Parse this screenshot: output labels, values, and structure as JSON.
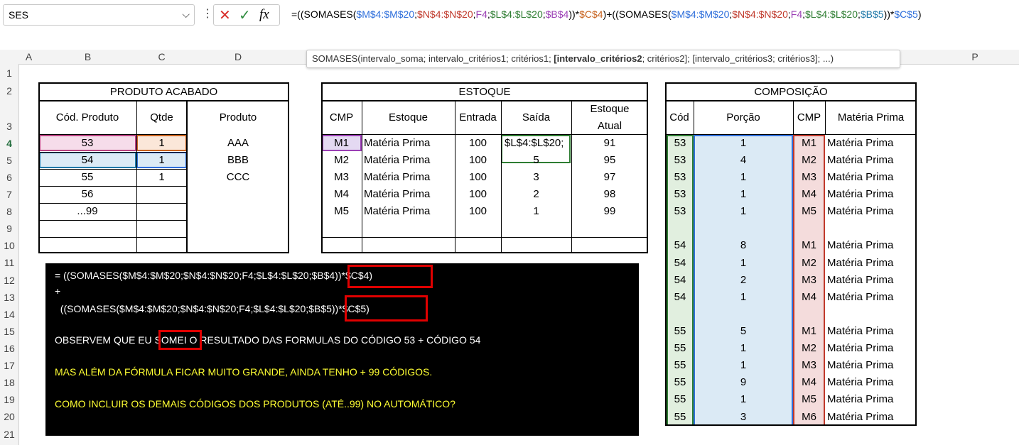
{
  "formula_bar": {
    "name_box": "SES",
    "more_icon": "⋮",
    "cancel_icon": "✕",
    "enter_icon": "✓",
    "fx_label": "fx",
    "formula_parts": [
      {
        "t": "=((SOMASES(",
        "c": "plain"
      },
      {
        "t": "$M$4:$M$20",
        "c": "blue"
      },
      {
        "t": ";",
        "c": "plain"
      },
      {
        "t": "$N$4:$N$20",
        "c": "red"
      },
      {
        "t": ";",
        "c": "plain"
      },
      {
        "t": "F4",
        "c": "purple"
      },
      {
        "t": ";",
        "c": "plain"
      },
      {
        "t": "$L$4:$L$20",
        "c": "green"
      },
      {
        "t": ";",
        "c": "plain"
      },
      {
        "t": "$B$4",
        "c": "purple"
      },
      {
        "t": "))*",
        "c": "plain"
      },
      {
        "t": "$C$4",
        "c": "orange"
      },
      {
        "t": ")+((SOMASES(",
        "c": "plain"
      },
      {
        "t": "$M$4:$M$20",
        "c": "blue"
      },
      {
        "t": ";",
        "c": "plain"
      },
      {
        "t": "$N$4:$N$20",
        "c": "red"
      },
      {
        "t": ";",
        "c": "plain"
      },
      {
        "t": "F4",
        "c": "purple"
      },
      {
        "t": ";",
        "c": "plain"
      },
      {
        "t": "$L$4:$L$20",
        "c": "green"
      },
      {
        "t": ";",
        "c": "plain"
      },
      {
        "t": "$B$5",
        "c": "teal"
      },
      {
        "t": "))*",
        "c": "plain"
      },
      {
        "t": "$C$5",
        "c": "blue"
      },
      {
        "t": ")",
        "c": "plain"
      }
    ]
  },
  "tooltip": {
    "pre": "SOMASES(intervalo_soma; intervalo_critérios1; critérios1; ",
    "bold": "[intervalo_critérios2",
    "post": "; critérios2]; [intervalo_critérios3; critérios3]; ...)"
  },
  "columns": [
    "A",
    "B",
    "C",
    "D",
    "",
    "",
    "",
    "",
    "",
    "",
    "",
    "",
    "",
    "",
    "",
    "P"
  ],
  "rows": [
    "1",
    "2",
    "3",
    "4",
    "5",
    "6",
    "7",
    "8",
    "9",
    "10",
    "11",
    "12",
    "13",
    "14",
    "15",
    "16",
    "17",
    "18",
    "19",
    "20",
    "21"
  ],
  "produto_acabado": {
    "title": "PRODUTO ACABADO",
    "headers": [
      "Cód. Produto",
      "Qtde",
      "Produto"
    ],
    "rows": [
      [
        "53",
        "1",
        "AAA"
      ],
      [
        "54",
        "1",
        "BBB"
      ],
      [
        "55",
        "1",
        "CCC"
      ],
      [
        "56",
        "",
        ""
      ],
      [
        "...99",
        "",
        ""
      ],
      [
        "",
        "",
        ""
      ],
      [
        "",
        "",
        ""
      ]
    ]
  },
  "estoque": {
    "title": "ESTOQUE",
    "headers": [
      "CMP",
      "Estoque",
      "Entrada",
      "Saída",
      "Estoque",
      "Atual"
    ],
    "rows": [
      [
        "M1",
        "Matéria Prima",
        "100",
        "$L$4:$L$20;",
        "91"
      ],
      [
        "M2",
        "Matéria Prima",
        "100",
        "5",
        "95"
      ],
      [
        "M3",
        "Matéria Prima",
        "100",
        "3",
        "97"
      ],
      [
        "M4",
        "Matéria Prima",
        "100",
        "2",
        "98"
      ],
      [
        "M5",
        "Matéria Prima",
        "100",
        "1",
        "99"
      ]
    ]
  },
  "composicao": {
    "title": "COMPOSIÇÃO",
    "headers": [
      "Cód",
      "Porção",
      "CMP",
      "Matéria Prima"
    ],
    "rows": [
      [
        "53",
        "1",
        "M1",
        "Matéria Prima"
      ],
      [
        "53",
        "4",
        "M2",
        "Matéria Prima"
      ],
      [
        "53",
        "1",
        "M3",
        "Matéria Prima"
      ],
      [
        "53",
        "1",
        "M4",
        "Matéria Prima"
      ],
      [
        "53",
        "1",
        "M5",
        "Matéria Prima"
      ],
      [
        "",
        "",
        "",
        ""
      ],
      [
        "54",
        "8",
        "M1",
        "Matéria Prima"
      ],
      [
        "54",
        "1",
        "M2",
        "Matéria Prima"
      ],
      [
        "54",
        "2",
        "M3",
        "Matéria Prima"
      ],
      [
        "54",
        "1",
        "M4",
        "Matéria Prima"
      ],
      [
        "",
        "",
        "",
        ""
      ],
      [
        "55",
        "5",
        "M1",
        "Matéria Prima"
      ],
      [
        "55",
        "1",
        "M2",
        "Matéria Prima"
      ],
      [
        "55",
        "1",
        "M3",
        "Matéria Prima"
      ],
      [
        "55",
        "9",
        "M4",
        "Matéria Prima"
      ],
      [
        "55",
        "1",
        "M5",
        "Matéria Prima"
      ],
      [
        "55",
        "3",
        "M6",
        "Matéria Prima"
      ]
    ]
  },
  "note": {
    "line1": "= ((SOMASES($M$4:$M$20;$N$4:$N$20;F4;$L$4:$L$20;$B$4))*$C$4)",
    "line2": "+",
    "line3": "  ((SOMASES($M$4:$M$20;$N$4:$N$20;F4;$L$4:$L$20;$B$5))*$C$5)",
    "line4": "OBSERVEM QUE EU SOMEI O RESULTADO DAS FORMULAS DO CÓDIGO 53  + CÓDIGO 54",
    "line5": "MAS ALÉM DA FÓRMULA FICAR MUITO GRANDE, AINDA TENHO + 99 CÓDIGOS.",
    "line6": "COMO INCLUIR OS DEMAIS CÓDIGOS DOS PRODUTOS (ATÉ..99) NO AUTOMÁTICO?"
  },
  "colors": {
    "formula_blue": "#2f6fdb",
    "formula_red": "#c0392b",
    "formula_purple": "#9b3fb5",
    "formula_green": "#2e7d32",
    "formula_orange": "#c8621d",
    "formula_teal": "#1f78a8",
    "highlight_pink": "#f6dcea",
    "highlight_blue": "#dbeaf5",
    "highlight_purple": "#e4d9f2",
    "note_yellow": "#ffff33",
    "annotation_red": "#e00000"
  }
}
